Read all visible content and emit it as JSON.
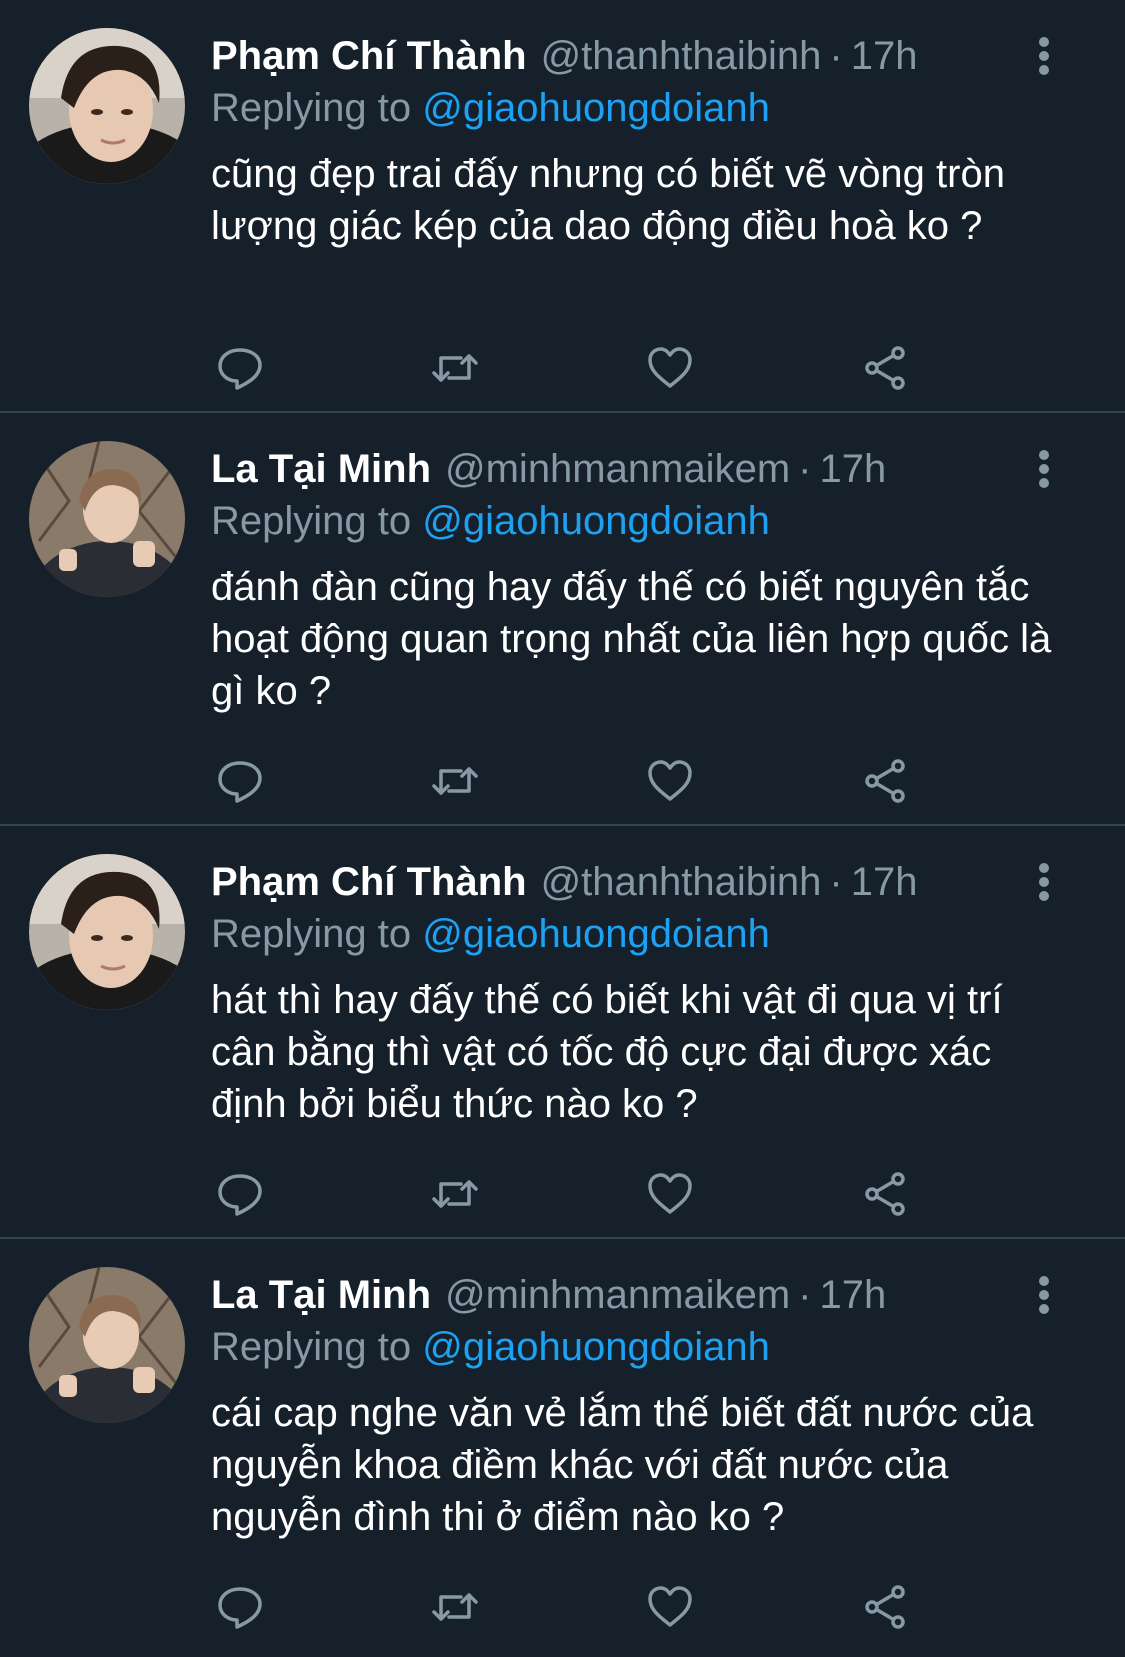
{
  "colors": {
    "background": "#15202b",
    "divider": "#38444d",
    "muted": "#8899a6",
    "link": "#1da1f2",
    "text": "#ffffff"
  },
  "reply_prefix": "Replying to",
  "tweets": [
    {
      "display_name": "Phạm Chí Thành",
      "handle": "@thanhthaibinh",
      "separator": "·",
      "time": "17h",
      "reply_to": "@giaohuongdoianh",
      "text": "cũng đẹp trai đấy nhưng có biết vẽ vòng tròn lượng giác kép của dao động điều hoà ko ?"
    },
    {
      "display_name": "La Tại Minh",
      "handle": "@minhmanmaikem",
      "separator": "·",
      "time": "17h",
      "reply_to": "@giaohuongdoianh",
      "text": "đánh đàn cũng hay đấy thế có biết nguyên tắc hoạt động quan trọng nhất của liên hợp quốc là gì ko ?"
    },
    {
      "display_name": "Phạm Chí Thành",
      "handle": "@thanhthaibinh",
      "separator": "·",
      "time": "17h",
      "reply_to": "@giaohuongdoianh",
      "text": "hát thì hay đấy thế có biết khi vật đi qua vị trí cân bằng thì vật có tốc độ cực đại được xác định bởi biểu thức nào ko ?"
    },
    {
      "display_name": "La Tại Minh",
      "handle": "@minhmanmaikem",
      "separator": "·",
      "time": "17h",
      "reply_to": "@giaohuongdoianh",
      "text": "cái cap nghe văn vẻ lắm thế biết đất nước của nguyễn khoa điềm khác với đất nước của nguyễn đình thi ở điểm nào ko ?"
    }
  ],
  "icons": {
    "reply": "reply-icon",
    "retweet": "retweet-icon",
    "like": "heart-icon",
    "share": "share-icon",
    "more": "more-vertical-icon"
  }
}
